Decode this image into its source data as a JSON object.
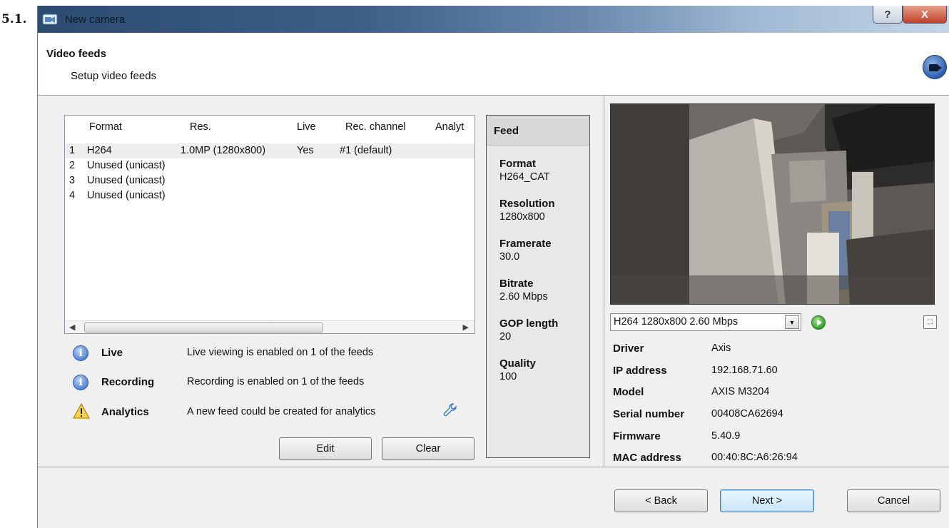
{
  "section_number": "5.1.",
  "window": {
    "title": "New camera",
    "help_label": "?",
    "close_label": "X"
  },
  "header": {
    "title": "Video feeds",
    "subtitle": "Setup video feeds"
  },
  "feeds_table": {
    "columns": [
      "Format",
      "Res.",
      "Live",
      "Rec. channel",
      "Analyt"
    ],
    "rows": [
      {
        "num": "1",
        "format": "H264",
        "res": "1.0MP (1280x800)",
        "live": "Yes",
        "rec": "#1 (default)",
        "selected": true
      },
      {
        "num": "2",
        "format": "Unused (unicast)",
        "res": "",
        "live": "",
        "rec": ""
      },
      {
        "num": "3",
        "format": "Unused (unicast)",
        "res": "",
        "live": "",
        "rec": ""
      },
      {
        "num": "4",
        "format": "Unused (unicast)",
        "res": "",
        "live": "",
        "rec": ""
      }
    ]
  },
  "status": {
    "live": {
      "label": "Live",
      "text": "Live viewing is enabled on 1 of the feeds",
      "icon": "info-icon"
    },
    "recording": {
      "label": "Recording",
      "text": "Recording is enabled on 1 of the feeds",
      "icon": "info-icon"
    },
    "analytics": {
      "label": "Analytics",
      "text": "A new feed could be created for analytics",
      "icon": "warning-icon"
    }
  },
  "buttons": {
    "edit": "Edit",
    "clear": "Clear",
    "back": "< Back",
    "next": "Next >",
    "cancel": "Cancel"
  },
  "feed_panel": {
    "title": "Feed",
    "fields": [
      {
        "label": "Format",
        "value": "H264_CAT"
      },
      {
        "label": "Resolution",
        "value": "1280x800"
      },
      {
        "label": "Framerate",
        "value": "30.0"
      },
      {
        "label": "Bitrate",
        "value": "2.60 Mbps"
      },
      {
        "label": "GOP length",
        "value": "20"
      },
      {
        "label": "Quality",
        "value": "100"
      }
    ]
  },
  "preview": {
    "stream_select": "H264 1280x800 2.60 Mbps"
  },
  "camera_info": [
    {
      "label": "Driver",
      "value": "Axis"
    },
    {
      "label": "IP address",
      "value": "192.168.71.60"
    },
    {
      "label": "Model",
      "value": "AXIS M3204"
    },
    {
      "label": "Serial number",
      "value": "00408CA62694"
    },
    {
      "label": "Firmware",
      "value": "5.40.9"
    },
    {
      "label": "MAC address",
      "value": "00:40:8C:A6:26:94"
    }
  ],
  "colors": {
    "title_bar": "#3d5f86",
    "window_bg": "#f0f0f0",
    "default_button": "#c8e6fa",
    "selected_row": "#eeeeee"
  }
}
